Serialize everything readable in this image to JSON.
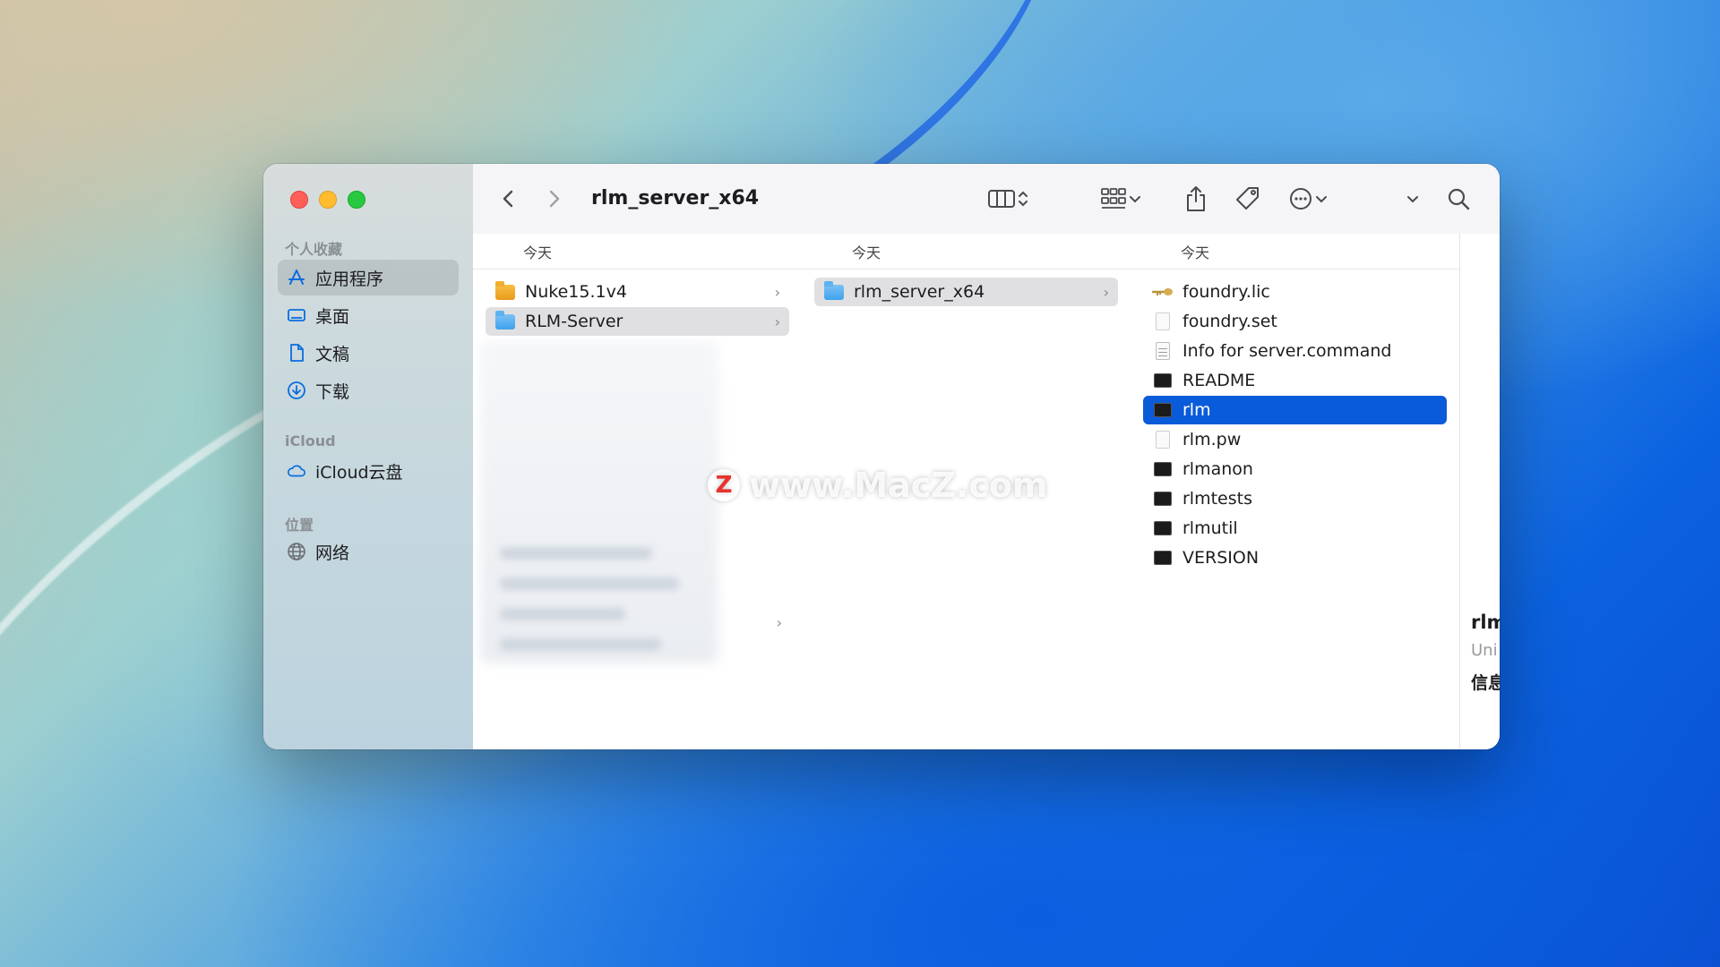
{
  "sidebar": {
    "favorites_title": "个人收藏",
    "favorites": [
      {
        "label": "应用程序",
        "icon": "apps-icon",
        "selected": true
      },
      {
        "label": "桌面",
        "icon": "desktop-icon"
      },
      {
        "label": "文稿",
        "icon": "document-icon"
      },
      {
        "label": "下载",
        "icon": "download-icon"
      }
    ],
    "icloud_title": "iCloud",
    "icloud": [
      {
        "label": "iCloud云盘",
        "icon": "cloud-icon"
      }
    ],
    "locations_title": "位置",
    "locations": [
      {
        "label": "网络",
        "icon": "globe-icon"
      }
    ]
  },
  "toolbar": {
    "title": "rlm_server_x64",
    "back_icon": "chevron-left-icon",
    "forward_icon": "chevron-right-icon"
  },
  "columns": [
    {
      "header": "今天",
      "items": [
        {
          "label": "Nuke15.1v4",
          "icon": "folder-orange-icon",
          "chevron": true
        },
        {
          "label": "RLM-Server",
          "icon": "folder-icon",
          "chevron": true,
          "state": "gray"
        }
      ]
    },
    {
      "header": "今天",
      "items": [
        {
          "label": "rlm_server_x64",
          "icon": "folder-icon",
          "chevron": true,
          "state": "gray"
        }
      ]
    },
    {
      "header": "今天",
      "items": [
        {
          "label": "foundry.lic",
          "icon": "key-icon"
        },
        {
          "label": "foundry.set",
          "icon": "doc-icon"
        },
        {
          "label": "Info for server.command",
          "icon": "text-doc-icon"
        },
        {
          "label": "README",
          "icon": "terminal-icon"
        },
        {
          "label": "rlm",
          "icon": "terminal-icon",
          "state": "blue"
        },
        {
          "label": "rlm.pw",
          "icon": "doc-icon"
        },
        {
          "label": "rlmanon",
          "icon": "terminal-icon"
        },
        {
          "label": "rlmtests",
          "icon": "terminal-icon"
        },
        {
          "label": "rlmutil",
          "icon": "terminal-icon"
        },
        {
          "label": "VERSION",
          "icon": "terminal-icon"
        }
      ]
    }
  ],
  "preview": {
    "name": "rlm",
    "kind": "Uni",
    "info": "信息"
  },
  "watermark": {
    "logo": "Z",
    "text": "www.MacZ.com"
  }
}
